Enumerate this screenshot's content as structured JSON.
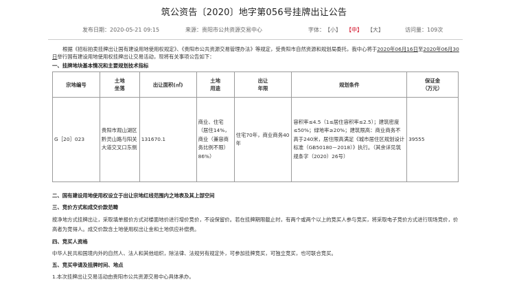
{
  "title": "筑公资告〔2020〕地字第056号挂牌出让公告",
  "meta": {
    "publish_date": "发布日期：2020-05-21 09:15",
    "source": "来源：贵阳市公共资源交易中心",
    "font_label": "字体：",
    "font_small": "【小】",
    "font_medium": "【中】",
    "font_large": "【大】",
    "views": "访问量：109次"
  },
  "intro": {
    "line1": "根据《招标拍卖挂牌出让国有建设用地使用权规定》、《贵阳市公共资源交易管理办法》等规定，受贵阳市自然资源和规划局委托，我中心将于",
    "date1": "2020年06月16日",
    "to": "至",
    "date2": "2020年06月30日",
    "line2": "举行国有建设用地使用权挂牌出让交易活动，现将有关事项公告如下："
  },
  "section1": "一、挂牌地块基本情况和主要规划技术指标",
  "table": {
    "headers": {
      "code": "宗地编号",
      "loc_1": "土地",
      "loc_2": "坐落",
      "area": "出让面积(㎡)",
      "use_1": "土地",
      "use_2": "用途",
      "term_1": "出让",
      "term_2": "年限",
      "plan": "规划条件",
      "deposit_1": "保证金",
      "deposit_2": "（万元）"
    },
    "row": {
      "code": "G［20］023",
      "location": "贵阳市观山湖区黔灵山路与阳关大道交叉口东侧",
      "area": "131670.1",
      "use": "商业、住宅（居住14%，商业（兼容商务比例不限）86%）",
      "term": "住宅70年，商业商务40年",
      "plan": "容积率≤4.5（1≤居住容积率≤2.5）；建筑密度≤50%；绿地率≥20%；建筑限高：商业商务不高于240米，居住限高满足《城市居住区规划设计标准（GB50180－2018）》执行。（其余详见筑规条字（2020）26号）",
      "deposit": "39555"
    }
  },
  "section2": "二、国有建设用地使用权设立于出让宗地红线范围内之地表及其上部空间",
  "section3": "三、竞价方式和成交价款范畴",
  "section3_text": "按净地方式挂牌出让，采取填单报价方式对楼面地价进行增价竞价，不设保留价。若在挂牌期限截止时，有两个或两个以上的竞买人参与竞买，将采取电子竞价方式进行现场竞价，价高者为竞得人。成交价款含土地使用权出让金和土地供应补偿费。",
  "section4": "四、竞买人资格",
  "section4_text": "中华人民共和国境内外的自然人、法人和其他组织，除法律、法规另有规定外，可参加挂牌竞买，可独立竞买，也可联合竞买。",
  "section5": "五、竞买申请及挂牌时间、地点",
  "section5_text": "1.本次挂牌出让交易活动由贵阳市公共资源交易中心具体承办。"
}
